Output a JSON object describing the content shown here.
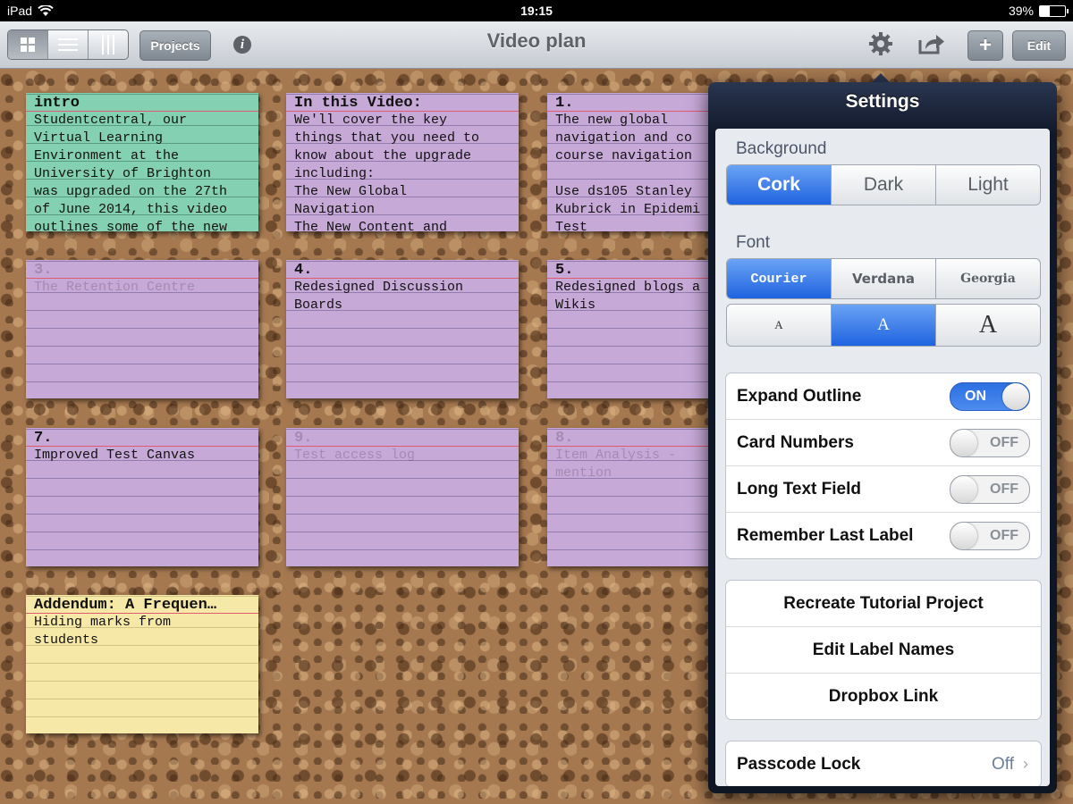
{
  "status_bar": {
    "device": "iPad",
    "time": "19:15",
    "battery": "39%",
    "battery_level": 0.39
  },
  "toolbar": {
    "projects_label": "Projects",
    "title": "Video plan",
    "add_label": "+",
    "edit_label": "Edit"
  },
  "cards": [
    {
      "title": "intro",
      "body": "Studentcentral, our\nVirtual Learning\nEnvironment at the\nUniversity of Brighton\nwas upgraded on the 27th\nof June 2014, this video\noutlines some of the new",
      "color": "green",
      "faded": false
    },
    {
      "title": "In this Video:",
      "body": "We'll cover the key\nthings that you need to\nknow about the upgrade\nincluding:\nThe New Global\nNavigation\nThe New Content and",
      "color": "purple",
      "faded": false
    },
    {
      "title": "1.",
      "body": "The new global\nnavigation and co\ncourse navigation\n\nUse ds105 Stanley\nKubrick in Epidemi\nTest",
      "color": "purple",
      "faded": false
    },
    {
      "title": "3.",
      "body": "The Retention Centre",
      "color": "purple",
      "faded": true
    },
    {
      "title": "4.",
      "body": "Redesigned Discussion\nBoards",
      "color": "purple",
      "faded": false
    },
    {
      "title": "5.",
      "body": "Redesigned blogs a\nWikis",
      "color": "purple",
      "faded": false
    },
    {
      "title": "7.",
      "body": "Improved Test Canvas",
      "color": "purple",
      "faded": false
    },
    {
      "title": "9.",
      "body": "Test access log",
      "color": "purple",
      "faded": true
    },
    {
      "title": "8.",
      "body": "Item Analysis -\nmention",
      "color": "purple",
      "faded": true
    },
    {
      "title": "Addendum: A Frequen…",
      "body": "Hiding marks from\nstudents",
      "color": "yellow",
      "faded": false
    }
  ],
  "settings": {
    "title": "Settings",
    "background": {
      "label": "Background",
      "options": [
        "Cork",
        "Dark",
        "Light"
      ],
      "selected": "Cork"
    },
    "font": {
      "label": "Font",
      "options": [
        "Courier",
        "Verdana",
        "Georgia"
      ],
      "selected": "Courier",
      "size_options": [
        "A",
        "A",
        "A"
      ],
      "size_selected": 1
    },
    "toggles": [
      {
        "label": "Expand Outline",
        "state": "ON"
      },
      {
        "label": "Card Numbers",
        "state": "OFF"
      },
      {
        "label": "Long Text Field",
        "state": "OFF"
      },
      {
        "label": "Remember Last Label",
        "state": "OFF"
      }
    ],
    "actions": [
      "Recreate Tutorial Project",
      "Edit Label Names",
      "Dropbox Link"
    ],
    "passcode": {
      "label": "Passcode Lock",
      "value": "Off"
    }
  },
  "colors": {
    "accent": "#2f74e8",
    "card_purple": "#c7a9d8",
    "card_green": "#83d1b2",
    "card_yellow": "#f6e8a6"
  },
  "icons": [
    "wifi-icon",
    "grid-view-icon",
    "list-view-icon",
    "columns-view-icon",
    "info-icon",
    "gear-icon",
    "share-icon",
    "chevron-right-icon"
  ]
}
